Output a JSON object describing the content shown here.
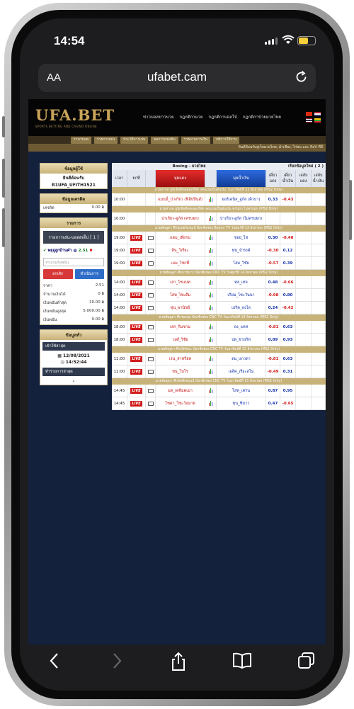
{
  "status": {
    "time": "14:54"
  },
  "browser": {
    "aa": "AA",
    "url": "ufabet.cam"
  },
  "site": {
    "logo": "UFA.BET",
    "logo_sub": "SPORTS BETTING AND CASINO ONLINE",
    "nav": [
      "ข่าวบอลข่าวบวย",
      "กฎกติกามวย",
      "กฎกติกาบอลโบ้",
      "กฎกติกาบ้วยมวยไทย"
    ],
    "menu": [
      "ราคาบอล",
      "รายการเล่น",
      "ประวัติการเล่น",
      "ผลการแข่งขัน",
      "รายงานการเงิน",
      "กติการใช้งาน"
    ],
    "ticker": "ยินดีต้อนรับสู่เว็บมวยไทย, ม้าเชียง, ไก่ชน และ RoV ที่ดี"
  },
  "sidebar": {
    "user_title": "ข้อมูลผู้ใช้",
    "welcome": "ยินดีต้อนรับ",
    "user_id": "R1UFA_UFITH1521",
    "credit_title": "ข้อมูลเครดิต",
    "credit_label": "เครดิต",
    "credit_value": "0.00 ฿",
    "list_title": "รายการ",
    "bet_panel": "รายการเล่น-บอลสเต็ป [ 1 ]",
    "pick_text": "พยุจูลูกบ้านคำ @",
    "pick_odds": "2.51",
    "amount_placeholder": "จำนวนเงินพนัน",
    "cancel_btn": "ยกเลิก",
    "confirm_btn": "ดำเนินการ",
    "info": [
      {
        "label": "ราคา",
        "value": "2.51"
      },
      {
        "label": "จำนวนเงินได้",
        "value": "0 ฿"
      },
      {
        "label": "เงินพนันต่ำสุด",
        "value": "10.00 ฿"
      },
      {
        "label": "เงินพนันสูงสุด",
        "value": "5,000.00 ฿"
      },
      {
        "label": "เงินพนัน",
        "value": "0.00 ฿"
      }
    ],
    "news_title": "ข้อมูลทั่ว",
    "last_login": "เข้าใช้ล่าสุด",
    "date": "12/08/2021",
    "clock": "14:52:44",
    "last_trans": "ทำรายการล่าสุด",
    "dash": "-"
  },
  "table": {
    "title": "Boxing - มวยไทย",
    "request_label": "เรียกข้อมูลใหม่ ( 2 )",
    "col_time": "เวลา",
    "col_live": "ยกที่",
    "home_head": "มุมแดง",
    "away_head": "มุมน้ำเงิน",
    "odd_cols": [
      "เดี่ยว แดง",
      "เดี่ยว น้ำเงิน",
      "เสลับ แดง",
      "เสลับ น้ำเงิน"
    ],
    "groups": [
      {
        "league": "มวยสากล ยูนิเซิฟติดดอดอร์จัด ลดแบนเป็นอันเงิน วันอาทิตย์ที่ 22 สิงหาคม (MS2 Only)",
        "rows": [
          {
            "time": "10:00",
            "live": "",
            "home": "แมนนี่_ปาเกียว (ฟิลิปปินส์)",
            "away": "ยอร์เดนิส_อูกัส (คิวบา)",
            "o1": "0.33",
            "o2": "-0.43"
          }
        ]
      },
      {
        "league": "มวยสากล ยูนิเซิฟติดดอดอร์จัด ลดแบนเป็นอันเงิน ครบยก ไม่ครบยก (MS2 Only)",
        "rows": [
          {
            "time": "10:00",
            "live": "",
            "home": "ปาเกียว-อูกัส (ครบยก)",
            "away": "ปาเกียว-อูกัส (ไม่ครบยก)",
            "o1": "",
            "o2": ""
          }
        ]
      },
      {
        "league": "มวยทัพพูดา ศึกซูเปอร์แชมป์ ป้อกซิ่งช่อง Bayon TV วันศุกร์ที่ 13 สิงหาคม (MS2 Only)",
        "rows": [
          {
            "time": "19:00",
            "live": "LIVE",
            "home": "แดม_เพียรน",
            "away": "ชอย_ไช",
            "o1": "0.30",
            "o2": "-0.48"
          },
          {
            "time": "19:00",
            "live": "LIVE",
            "home": "ลิน_วิเรียะ",
            "away": "ทุน_จำรงค์",
            "o1": "-0.30",
            "o2": "0.12"
          },
          {
            "time": "19:00",
            "live": "LIVE",
            "home": "เอม_โชกที่",
            "away": "โสม_วิชัย",
            "o1": "-0.57",
            "o2": "0.39"
          }
        ]
      },
      {
        "league": "มวยทัพพูดา ศึกกาชนาว บ้อกซิ่งช่อง CNC TV วันศุกร์ที่ 14 สิงหาคม (MS2 Only)",
        "rows": [
          {
            "time": "14:00",
            "live": "LIVE",
            "home": "เลา_ไชแนท",
            "away": "ทล_เทจ",
            "o1": "0.48",
            "o2": "-0.66"
          },
          {
            "time": "14:00",
            "live": "LIVE",
            "home": "โสท_ไชะดีม",
            "away": "เกียม_โซะวันนา",
            "o1": "-0.98",
            "o2": "0.80"
          },
          {
            "time": "14:00",
            "live": "LIVE",
            "home": "ทุน_พานิชย์",
            "away": "เอริค_ลงไล",
            "o1": "0.24",
            "o2": "-0.42"
          }
        ]
      },
      {
        "league": "มวยทัพพูดา ศึกรองบุล บ้อกซิ่งช่อง CNC TV วันอาทิตย์ที่ 14 สิงหาคม (MS2 Only)",
        "rows": [
          {
            "time": "18:00",
            "live": "LIVE",
            "home": "เสก_กิมชาน",
            "away": "ลง_แคท",
            "o1": "-0.81",
            "o2": "0.63"
          },
          {
            "time": "18:00",
            "live": "LIVE",
            "home": "วงศ์_วิชัย",
            "away": "ปด_ชายกิท",
            "o1": "0.89",
            "o2": "0.93"
          }
        ]
      },
      {
        "league": "มวยทัพพูดา ศึกเลิศชนะ บ้อกซิ่งช่อง CNC TV วันอาทิตย์ที่ 15 สิงหาคม (MS2 Only)",
        "rows": [
          {
            "time": "11:00",
            "live": "LIVE",
            "home": "เรน_สาหรีอท",
            "away": "ดม_แกวดา",
            "o1": "-0.81",
            "o2": "0.63"
          },
          {
            "time": "11:00",
            "live": "LIVE",
            "home": "ทน_โบโร",
            "away": "เอลิค_เรือะสโม",
            "o1": "-0.49",
            "o2": "0.31"
          }
        ]
      },
      {
        "league": "มวยทัพพูดา ศึกอัลพีเซอนน์ บ้อกซิ่งช่อง CNC TV วันอาทิตย์ที่ 15 สิงหาคม (MS2 Only)",
        "rows": [
          {
            "time": "14:45",
            "live": "LIVE",
            "home": "มด_เคลิมตเมา",
            "away": "โสท_เครน",
            "o1": "0.87",
            "o2": "0.95"
          },
          {
            "time": "14:45",
            "live": "LIVE",
            "home": "โซดา_โซะวันมาย",
            "away": "ทุน_ซิมาว",
            "o1": "0.47",
            "o2": "-0.65"
          }
        ]
      }
    ]
  }
}
